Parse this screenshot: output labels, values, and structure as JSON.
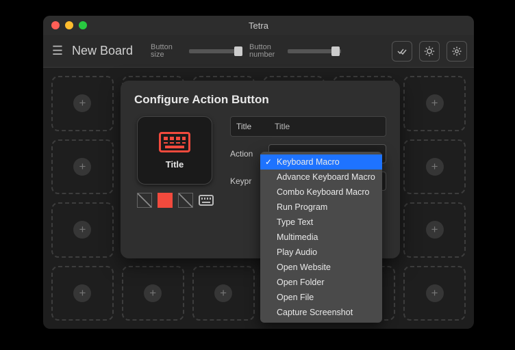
{
  "window": {
    "title": "Tetra"
  },
  "toolbar": {
    "board_title": "New Board",
    "slider1_label": "Button\nsize",
    "slider2_label": "Button\nnumber",
    "slider1_pos": 0.85,
    "slider2_pos": 0.82
  },
  "grid": {
    "rows": 4,
    "cols": 6
  },
  "modal": {
    "title": "Configure Action Button",
    "preview_label": "Title",
    "fields": {
      "title_label": "Title",
      "title_value": "Title",
      "action_label": "Action",
      "keypress_label": "Keypr"
    }
  },
  "dropdown": {
    "selected_index": 0,
    "items": [
      "Keyboard Macro",
      "Advance Keyboard Macro",
      "Combo Keyboard Macro",
      "Run Program",
      "Type Text",
      "Multimedia",
      "Play Audio",
      "Open Website",
      "Open Folder",
      "Open File",
      "Capture Screenshot"
    ]
  },
  "colors": {
    "accent": "#f24a3d",
    "selection": "#1e73ff"
  }
}
